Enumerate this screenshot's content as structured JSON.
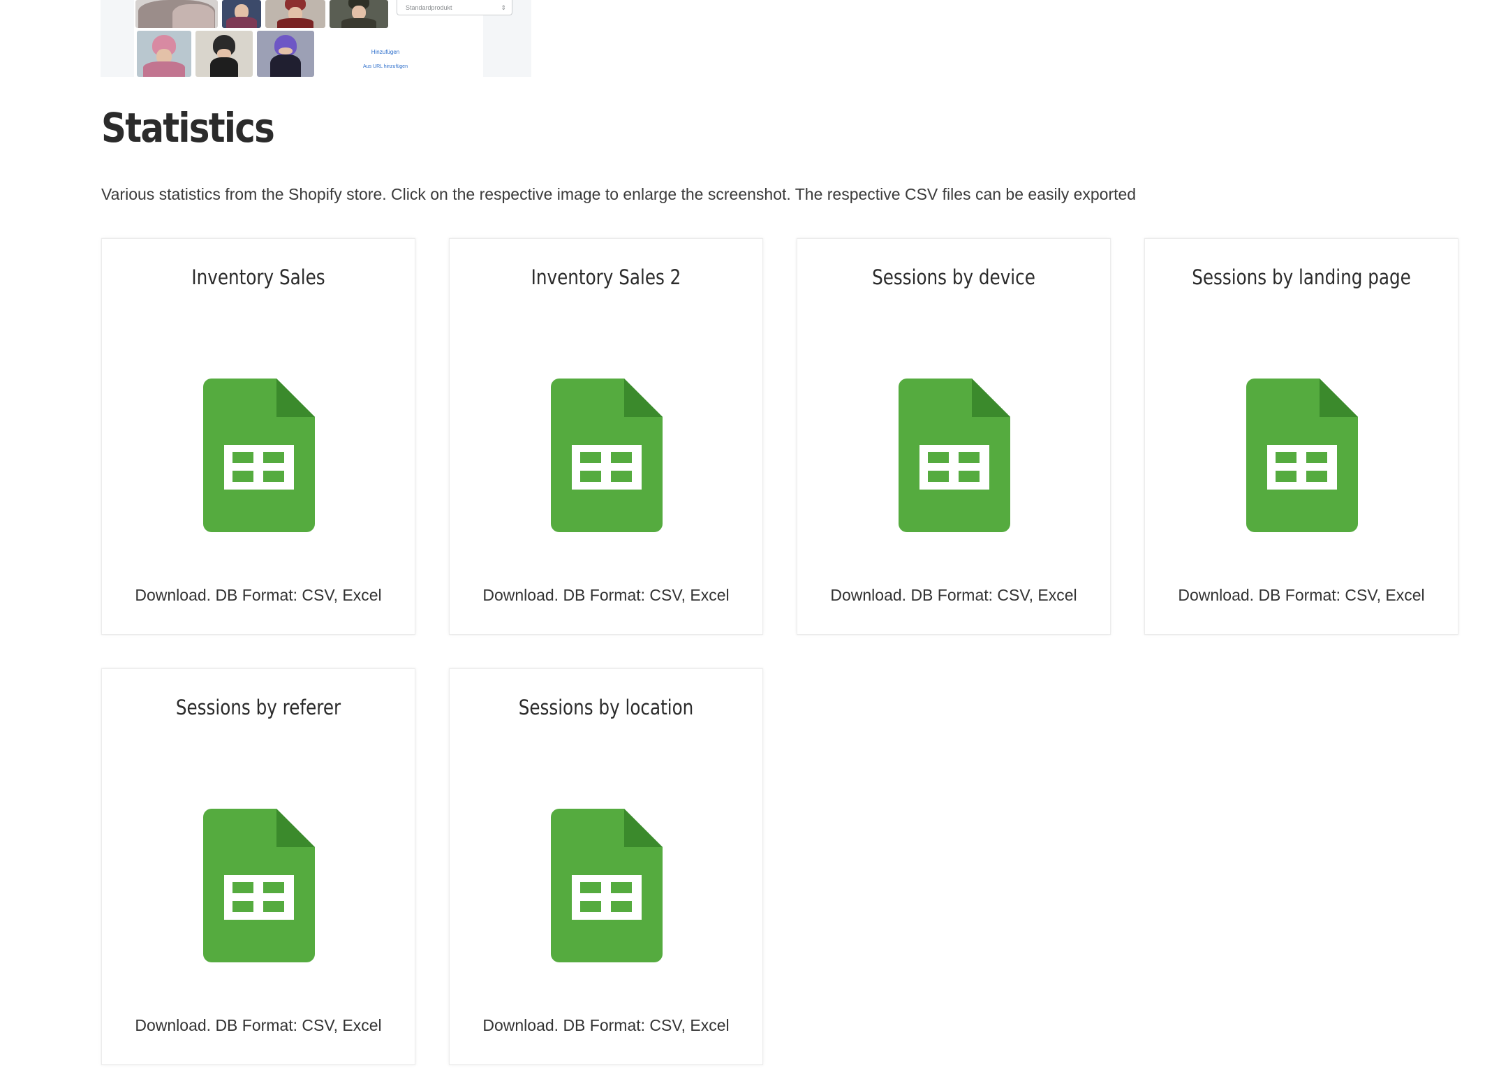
{
  "preview": {
    "select_value": "Standardprodukt",
    "select_arrow": "⇕",
    "add_link": "Hinzufügen",
    "url_link": "Aus URL hinzufügen"
  },
  "section": {
    "title": "Statistics",
    "description": "Various statistics from the Shopify store. Click on the respective image to enlarge the screenshot. The respective CSV files can be easily exported"
  },
  "cards": [
    {
      "title": "Inventory Sales",
      "icon": "spreadsheet-icon",
      "footer": "Download. DB Format: CSV, Excel"
    },
    {
      "title": "Inventory Sales 2",
      "icon": "spreadsheet-icon",
      "footer": "Download. DB Format: CSV, Excel"
    },
    {
      "title": "Sessions by device",
      "icon": "spreadsheet-icon",
      "footer": "Download. DB Format: CSV, Excel"
    },
    {
      "title": "Sessions by landing page",
      "icon": "spreadsheet-icon",
      "footer": "Download. DB Format: CSV, Excel"
    },
    {
      "title": "Sessions by referer",
      "icon": "spreadsheet-icon",
      "footer": "Download. DB Format: CSV, Excel"
    },
    {
      "title": "Sessions by location",
      "icon": "spreadsheet-icon",
      "footer": "Download. DB Format: CSV, Excel"
    }
  ],
  "colors": {
    "sheet_green": "#55ab3f",
    "sheet_fold": "#3b8a2c",
    "sheet_grid": "#ffffff",
    "link_blue": "#2c6ecb"
  }
}
